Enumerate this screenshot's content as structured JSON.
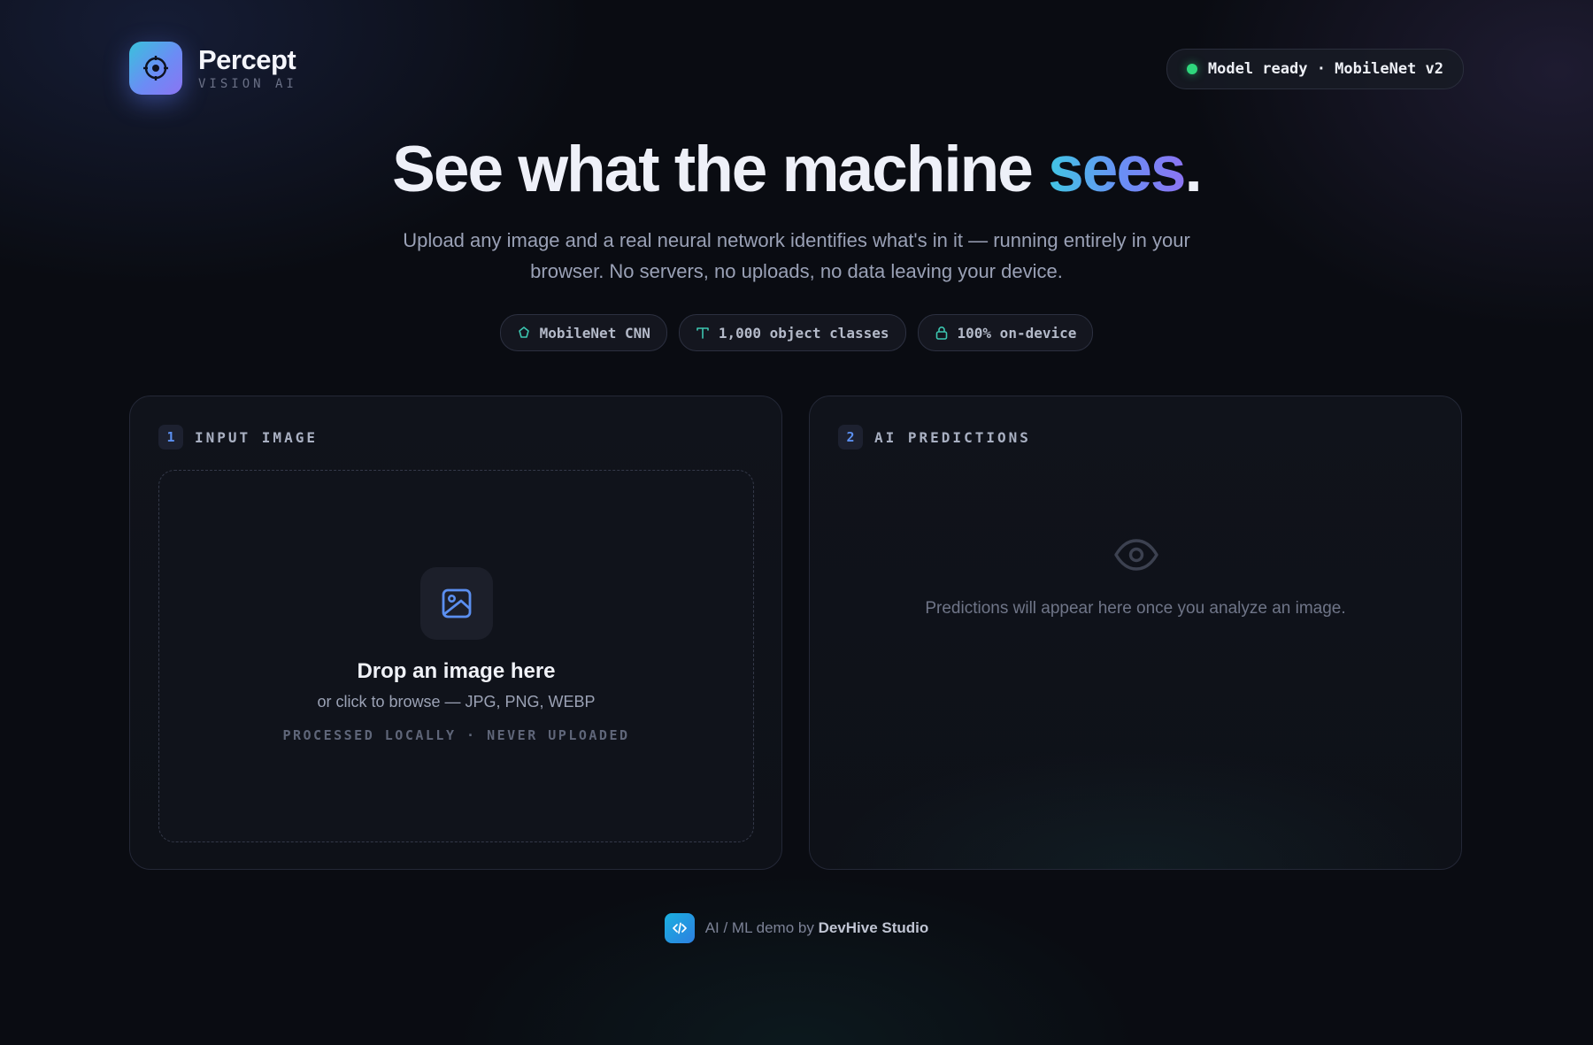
{
  "brand": {
    "name": "Percept",
    "tagline": "VISION AI"
  },
  "status": {
    "text": "Model ready · MobileNet v2",
    "color": "#2fd67c"
  },
  "hero": {
    "title_main": "See what the machine ",
    "title_accent": "sees",
    "title_end": ".",
    "subtitle": "Upload any image and a real neural network identifies what's in it — running entirely in your browser. No servers, no uploads, no data leaving your device."
  },
  "chips": [
    {
      "icon": "chip-icon",
      "label": "MobileNet CNN"
    },
    {
      "icon": "text-icon",
      "label": "1,000 object classes"
    },
    {
      "icon": "lock-icon",
      "label": "100% on-device"
    }
  ],
  "input_panel": {
    "step": "1",
    "title": "INPUT IMAGE",
    "drop_icon": "image-icon",
    "drop_title": "Drop an image here",
    "drop_subtitle": "or click to browse — JPG, PNG, WEBP",
    "drop_note": "PROCESSED LOCALLY · NEVER UPLOADED"
  },
  "predictions_panel": {
    "step": "2",
    "title": "AI PREDICTIONS",
    "empty_icon": "eye-icon",
    "empty_text": "Predictions will appear here once you analyze an image."
  },
  "footer": {
    "icon": "code-icon",
    "prefix": "AI / ML demo by ",
    "studio": "DevHive Studio"
  },
  "colors": {
    "accent_blue": "#5b8ff0",
    "accent_cyan": "#41c6e3",
    "accent_violet": "#8c74f3",
    "chip_icon": "#3cc6b0"
  }
}
